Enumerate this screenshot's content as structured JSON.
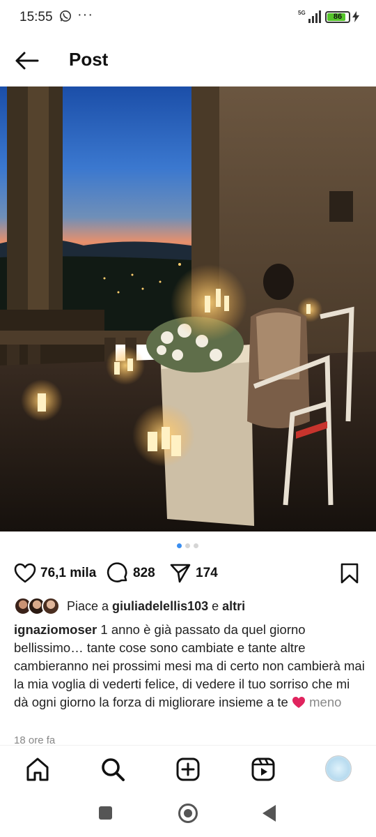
{
  "status_bar": {
    "time": "15:55",
    "network": "5G",
    "battery": "86",
    "battery_fraction": 0.86
  },
  "header": {
    "title": "Post"
  },
  "carousel": {
    "count": 3,
    "active": 1
  },
  "actions": {
    "likes": "76,1 mila",
    "comments": "828",
    "shares": "174"
  },
  "liked_by": {
    "prefix": "Piace a ",
    "user": "giuliadelellis103",
    "joiner": " e ",
    "others": "altri"
  },
  "caption": {
    "username": "ignaziomoser",
    "text": " 1 anno è già passato da quel giorno bellissimo… tante cose sono cambiate e tante altre cambieranno nei prossimi mesi ma di certo non cambierà mai la mia voglia di vederti felice, di vedere il tuo sorriso che mi dà ogni giorno la forza di migliorare insieme a te ",
    "emoji": "❤️",
    "more": "meno"
  },
  "timestamp": "18 ore fa",
  "icons": {
    "back": "arrow-left-icon",
    "like": "heart-icon",
    "comment": "comment-bubble-icon",
    "share": "paper-plane-icon",
    "save": "bookmark-icon",
    "nav": [
      "home-icon",
      "search-icon",
      "create-icon",
      "reels-icon",
      "profile-avatar"
    ]
  },
  "colors": {
    "accent": "#3a8ef0",
    "battery": "#55c52b",
    "heart": "#e0245e"
  }
}
